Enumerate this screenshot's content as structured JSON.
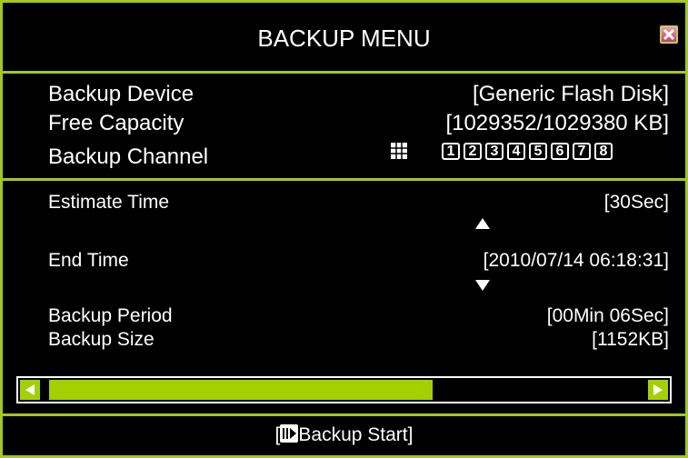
{
  "title": "BACKUP MENU",
  "info": {
    "device_label": "Backup Device",
    "device_value": "[Generic Flash Disk]",
    "capacity_label": "Free Capacity",
    "capacity_value": "[1029352/1029380 KB]",
    "channel_label": "Backup Channel",
    "channels": [
      "1",
      "2",
      "3",
      "4",
      "5",
      "6",
      "7",
      "8"
    ]
  },
  "details": {
    "estimate_label": "Estimate Time",
    "estimate_value": "[30Sec]",
    "end_label": "End Time",
    "end_value": "[2010/07/14 06:18:31]",
    "period_label": "Backup Period",
    "period_value": "[00Min 06Sec]",
    "size_label": "Backup Size",
    "size_value": "[1152KB]"
  },
  "progress": {
    "fraction": 0.64
  },
  "footer": {
    "open": "[",
    "label": "Backup Start]"
  },
  "colors": {
    "accent": "#a4c81c",
    "bar_fill": "#a4d000"
  },
  "icons": {
    "close": "close-x-icon",
    "grid": "grid-icon",
    "play": "play-icon"
  }
}
